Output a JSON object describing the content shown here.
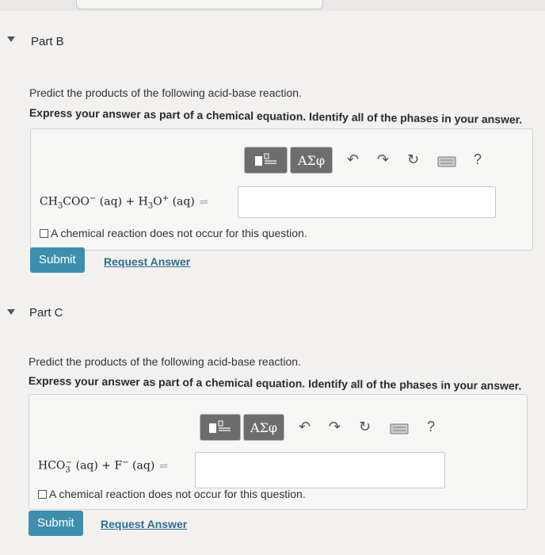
{
  "partB": {
    "title": "Part B",
    "prompt": "Predict the products of the following acid-base reaction.",
    "instruction": "Express your answer as part of a chemical equation. Identify all of the phases in your answer.",
    "toolbar": {
      "greek_label": "ΑΣφ",
      "help_label": "?"
    },
    "equation": {
      "r1": "CH",
      "r1_sub": "3",
      "r1_rest": "COO",
      "r1_sup": "−",
      "r1_phase": " (aq) + H",
      "r2_sub": "3",
      "r2_rest": "O",
      "r2_sup": "+",
      "r2_phase": " (aq)",
      "arrow": "⇌"
    },
    "answer_value": "",
    "no_reaction_label": "A chemical reaction does not occur for this question.",
    "submit_label": "Submit",
    "request_label": "Request Answer"
  },
  "partC": {
    "title": "Part C",
    "prompt": "Predict the products of the following acid-base reaction.",
    "instruction": "Express your answer as part of a chemical equation. Identify all of the phases in your answer.",
    "toolbar": {
      "greek_label": "ΑΣφ",
      "help_label": "?"
    },
    "equation": {
      "r1": "HCO",
      "r1_sub": "3",
      "r1_sup": "−",
      "r1_phase": " (aq) + F",
      "r2_sup": "−",
      "r2_phase": " (aq)",
      "arrow": "⇌"
    },
    "answer_value": "",
    "no_reaction_label": "A chemical reaction does not occur for this question.",
    "submit_label": "Submit",
    "request_label": "Request Answer"
  }
}
